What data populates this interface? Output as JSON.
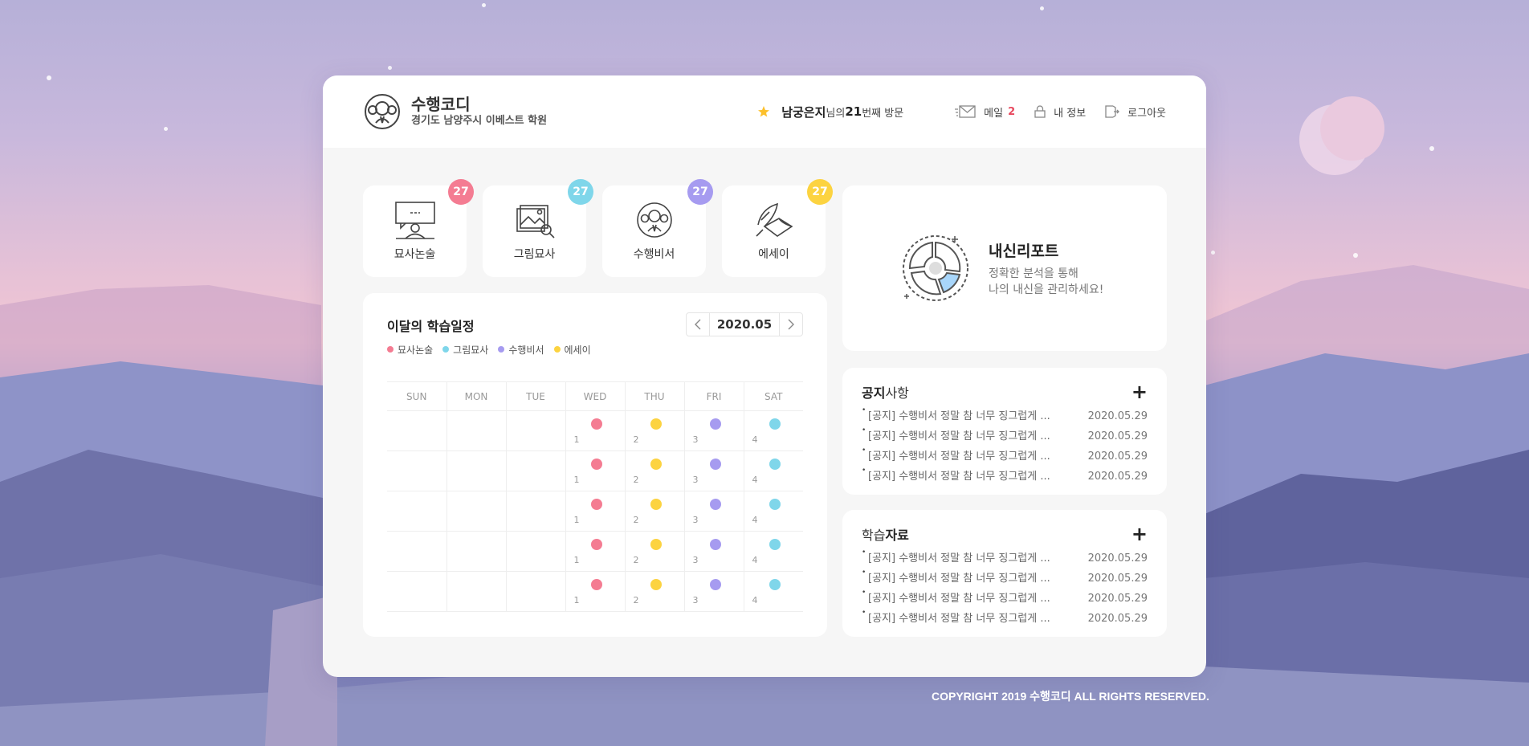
{
  "brand": {
    "name": "수행코디",
    "subtitle": "경기도 남양주시 이베스트 학원"
  },
  "header": {
    "user_name": "남궁은지",
    "visit_suffix_1": "님의 ",
    "visit_count": "21",
    "visit_suffix_2": "번째 방문",
    "mail_label": "메일",
    "mail_count": "2",
    "myinfo_label": "내 정보",
    "logout_label": "로그아웃"
  },
  "tiles": [
    {
      "label": "묘사논술",
      "count": "27",
      "color": "#f47c92"
    },
    {
      "label": "그림묘사",
      "count": "27",
      "color": "#7fd6ea"
    },
    {
      "label": "수행비서",
      "count": "27",
      "color": "#a69bf0"
    },
    {
      "label": "에세이",
      "count": "27",
      "color": "#fcd340"
    }
  ],
  "schedule": {
    "title": "이달의 학습일정",
    "month": "2020.05",
    "legend": [
      {
        "label": "묘사논술",
        "color": "#f47c92"
      },
      {
        "label": "그림묘사",
        "color": "#7fd6ea"
      },
      {
        "label": "수행비서",
        "color": "#a69bf0"
      },
      {
        "label": "에세이",
        "color": "#fcd340"
      }
    ],
    "weekdays": [
      "SUN",
      "MON",
      "TUE",
      "WED",
      "THU",
      "FRI",
      "SAT"
    ],
    "week_cells": [
      {
        "day": "1",
        "color": "#f47c92"
      },
      {
        "day": "2",
        "color": "#fcd340"
      },
      {
        "day": "3",
        "color": "#a69bf0"
      },
      {
        "day": "4",
        "color": "#7fd6ea"
      }
    ]
  },
  "report": {
    "title": "내신리포트",
    "desc_1": "정확한 분석을 통해",
    "desc_2": "나의 내신을 관리하세요!"
  },
  "notice": {
    "title_bold": "공지",
    "title_rest": "사항",
    "items": [
      {
        "text": "[공지] 수행비서 정말 참 너무 징그럽게 ...",
        "date": "2020.05.29"
      },
      {
        "text": "[공지] 수행비서 정말 참 너무 징그럽게 ...",
        "date": "2020.05.29"
      },
      {
        "text": "[공지] 수행비서 정말 참 너무 징그럽게 ...",
        "date": "2020.05.29"
      },
      {
        "text": "[공지] 수행비서 정말 참 너무 징그럽게 ...",
        "date": "2020.05.29"
      }
    ]
  },
  "materials": {
    "title_rest": "학습",
    "title_bold": "자료",
    "items": [
      {
        "text": "[공지] 수행비서 정말 참 너무 징그럽게 ...",
        "date": "2020.05.29"
      },
      {
        "text": "[공지] 수행비서 정말 참 너무 징그럽게 ...",
        "date": "2020.05.29"
      },
      {
        "text": "[공지] 수행비서 정말 참 너무 징그럽게 ...",
        "date": "2020.05.29"
      },
      {
        "text": "[공지] 수행비서 정말 참 너무 징그럽게 ...",
        "date": "2020.05.29"
      }
    ]
  },
  "footer": {
    "copyright": "COPYRIGHT 2019 수행코디 ALL RIGHTS RESERVED."
  }
}
